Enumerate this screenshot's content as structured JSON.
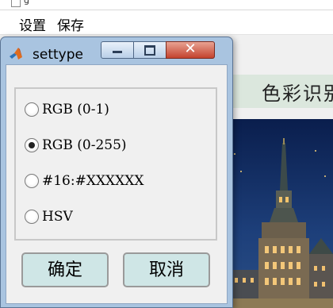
{
  "background_window": {
    "title_char": "g",
    "menu": [
      "设置",
      "保存"
    ],
    "header_text": "色彩识别"
  },
  "dialog": {
    "title": "settype",
    "icon": "matlab-icon",
    "options": [
      {
        "label": "RGB (0-1)",
        "checked": false
      },
      {
        "label": "RGB (0-255)",
        "checked": true
      },
      {
        "label": "#16:#XXXXXX",
        "checked": false
      },
      {
        "label": "HSV",
        "checked": false
      }
    ],
    "ok_label": "确定",
    "cancel_label": "取消",
    "caption_buttons": [
      "minimize-icon",
      "maximize-icon",
      "close-icon"
    ]
  },
  "colors": {
    "dialog_frame": "#a9c4e0",
    "button_fill": "#cfe6e6",
    "header_fill": "#dbe7dd",
    "close_button": "#c4432e"
  }
}
